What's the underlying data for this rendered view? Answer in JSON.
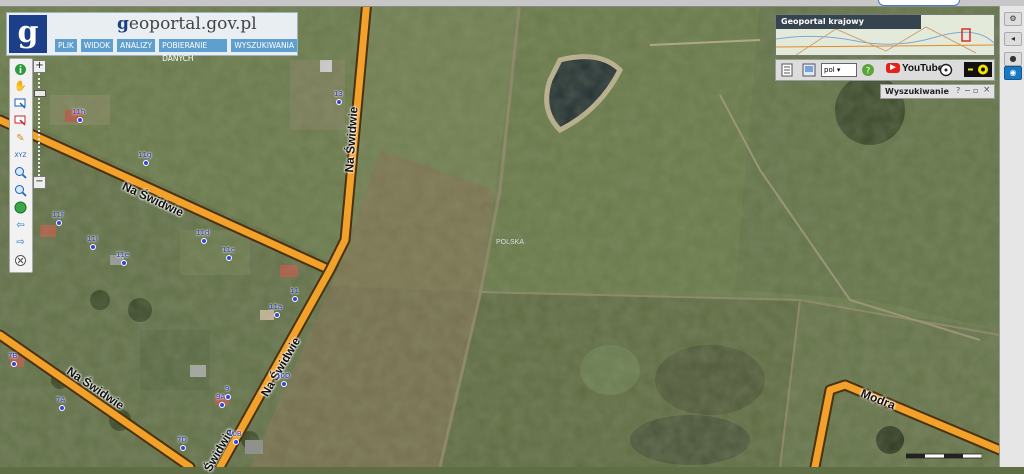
{
  "logo": {
    "brand": "g",
    "site_prefix": "g",
    "site_name": "eoportal.gov.pl"
  },
  "menu": [
    {
      "label": "PLIK",
      "name": "menu-plik"
    },
    {
      "label": "WIDOK",
      "name": "menu-widok"
    },
    {
      "label": "ANALIZY",
      "name": "menu-analizy"
    },
    {
      "label": "POBIERANIE DANYCH",
      "name": "menu-pobieranie-danych"
    },
    {
      "label": "WYSZUKIWANIA",
      "name": "menu-wyszukiwania"
    }
  ],
  "toolbar": {
    "icons": [
      "info-icon",
      "pan-hand-icon",
      "select-icon",
      "select-rect-icon",
      "measure-pencil-icon",
      "coordinates-icon",
      "zoom-in-tool-icon",
      "zoom-out-tool-icon",
      "globe-icon",
      "back-arrow-icon",
      "forward-arrow-icon",
      "clear-icon"
    ]
  },
  "zoom": {
    "plus": "+",
    "minus": "−"
  },
  "overview": {
    "title": "Geoportal krajowy"
  },
  "iconbar": {
    "language": "pol",
    "youtube": "YouTube"
  },
  "search": {
    "title": "Wyszukiwanie"
  },
  "map": {
    "country_label": "POLSKA",
    "streets": [
      {
        "name": "street-na-swidwie-1",
        "label": "Na Świdwie"
      },
      {
        "name": "street-na-swidwie-2",
        "label": "Na Świdwie"
      },
      {
        "name": "street-na-swidwie-3",
        "label": "Na Świdwie"
      },
      {
        "name": "street-na-swidwie-4",
        "label": "Na Świdwie"
      },
      {
        "name": "street-na-swidwie-5",
        "label": "Świdwie"
      },
      {
        "name": "street-modra",
        "label": "Modra"
      }
    ],
    "addresses": [
      "11h",
      "13",
      "11g",
      "11f",
      "11i",
      "11e",
      "11d",
      "11c",
      "11",
      "11a",
      "10D",
      "9",
      "9A",
      "7B",
      "7A",
      "7D",
      "10B"
    ]
  },
  "colors": {
    "road_fill": "#f2a12a",
    "road_edge": "#4a3210",
    "address": "#2a3cc8",
    "logo_blue": "#1d3f8a",
    "menu_blue": "#5f9fcf"
  }
}
